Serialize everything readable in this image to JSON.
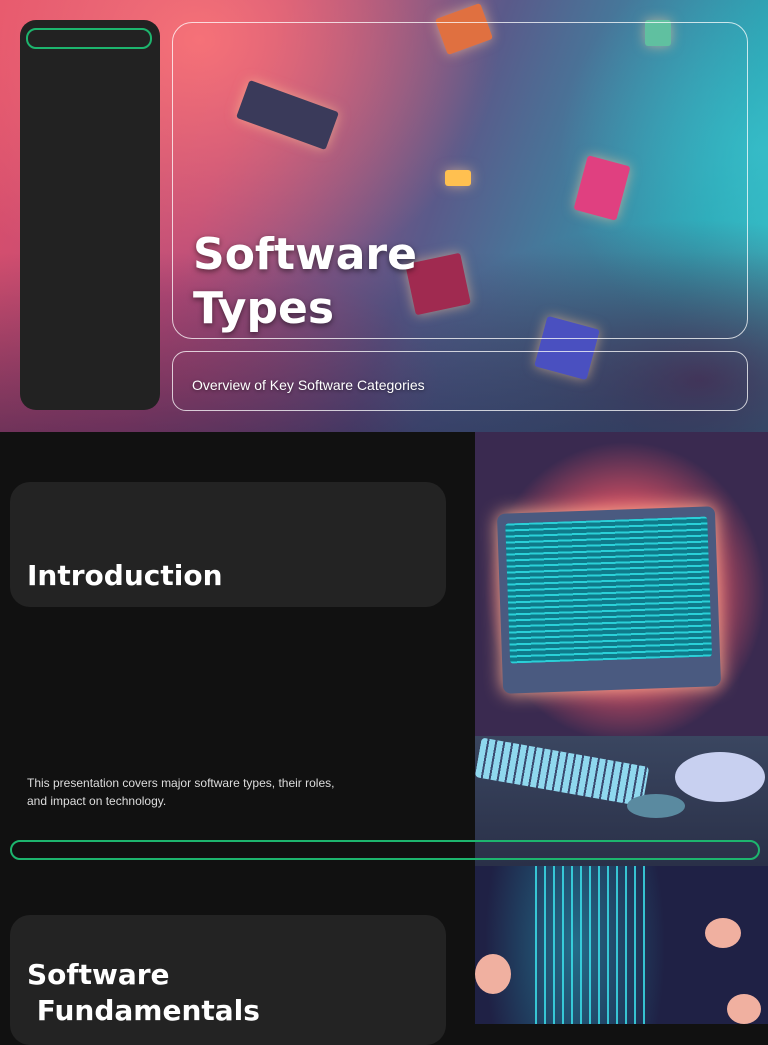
{
  "hero": {
    "title": "Software\nTypes",
    "subtitle": "Overview of Key Software Categories"
  },
  "intro": {
    "heading": "Introduction",
    "body": "This presentation covers major software types, their roles, and impact on technology."
  },
  "fundamentals": {
    "heading": "Software\n Fundamentals"
  },
  "colors": {
    "accent": "#1db56e",
    "card": "#232323",
    "background": "#111111"
  }
}
